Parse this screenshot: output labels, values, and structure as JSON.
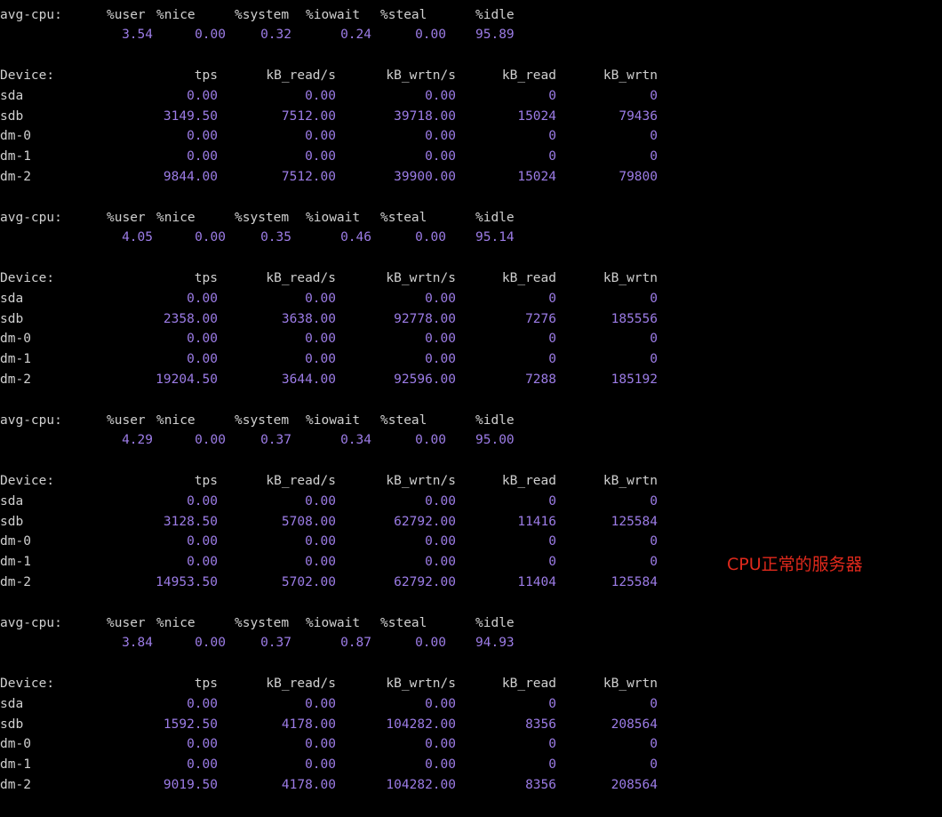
{
  "annotation": "CPU正常的服务器",
  "colors": {
    "background": "#000000",
    "label": "#d0d0d0",
    "number": "#9c7ce6",
    "annotation": "#e0291c"
  },
  "cpu_label": "avg-cpu:",
  "cpu_headers": [
    "%user",
    "%nice",
    "%system",
    "%iowait",
    "%steal",
    "%idle"
  ],
  "device_headers": [
    "Device:",
    "tps",
    "kB_read/s",
    "kB_wrtn/s",
    "kB_read",
    "kB_wrtn"
  ],
  "reports": [
    {
      "cpu": [
        "3.54",
        "0.00",
        "0.32",
        "0.24",
        "0.00",
        "95.89"
      ],
      "devices": [
        [
          "sda",
          "0.00",
          "0.00",
          "0.00",
          "0",
          "0"
        ],
        [
          "sdb",
          "3149.50",
          "7512.00",
          "39718.00",
          "15024",
          "79436"
        ],
        [
          "dm-0",
          "0.00",
          "0.00",
          "0.00",
          "0",
          "0"
        ],
        [
          "dm-1",
          "0.00",
          "0.00",
          "0.00",
          "0",
          "0"
        ],
        [
          "dm-2",
          "9844.00",
          "7512.00",
          "39900.00",
          "15024",
          "79800"
        ]
      ]
    },
    {
      "cpu": [
        "4.05",
        "0.00",
        "0.35",
        "0.46",
        "0.00",
        "95.14"
      ],
      "devices": [
        [
          "sda",
          "0.00",
          "0.00",
          "0.00",
          "0",
          "0"
        ],
        [
          "sdb",
          "2358.00",
          "3638.00",
          "92778.00",
          "7276",
          "185556"
        ],
        [
          "dm-0",
          "0.00",
          "0.00",
          "0.00",
          "0",
          "0"
        ],
        [
          "dm-1",
          "0.00",
          "0.00",
          "0.00",
          "0",
          "0"
        ],
        [
          "dm-2",
          "19204.50",
          "3644.00",
          "92596.00",
          "7288",
          "185192"
        ]
      ]
    },
    {
      "cpu": [
        "4.29",
        "0.00",
        "0.37",
        "0.34",
        "0.00",
        "95.00"
      ],
      "devices": [
        [
          "sda",
          "0.00",
          "0.00",
          "0.00",
          "0",
          "0"
        ],
        [
          "sdb",
          "3128.50",
          "5708.00",
          "62792.00",
          "11416",
          "125584"
        ],
        [
          "dm-0",
          "0.00",
          "0.00",
          "0.00",
          "0",
          "0"
        ],
        [
          "dm-1",
          "0.00",
          "0.00",
          "0.00",
          "0",
          "0"
        ],
        [
          "dm-2",
          "14953.50",
          "5702.00",
          "62792.00",
          "11404",
          "125584"
        ]
      ]
    },
    {
      "cpu": [
        "3.84",
        "0.00",
        "0.37",
        "0.87",
        "0.00",
        "94.93"
      ],
      "devices": [
        [
          "sda",
          "0.00",
          "0.00",
          "0.00",
          "0",
          "0"
        ],
        [
          "sdb",
          "1592.50",
          "4178.00",
          "104282.00",
          "8356",
          "208564"
        ],
        [
          "dm-0",
          "0.00",
          "0.00",
          "0.00",
          "0",
          "0"
        ],
        [
          "dm-1",
          "0.00",
          "0.00",
          "0.00",
          "0",
          "0"
        ],
        [
          "dm-2",
          "9019.50",
          "4178.00",
          "104282.00",
          "8356",
          "208564"
        ]
      ]
    }
  ]
}
